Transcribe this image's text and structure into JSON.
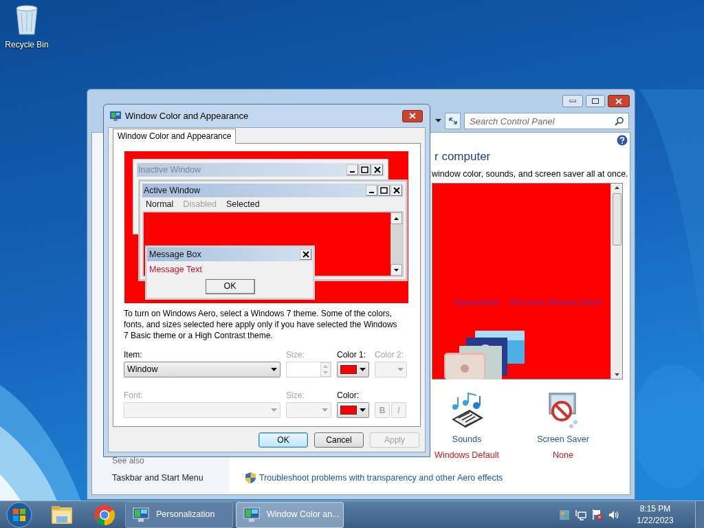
{
  "desktop_icons": [
    {
      "label": "Recycle Bin"
    }
  ],
  "personalization": {
    "search_placeholder": "Search Control Panel",
    "heading": "r computer",
    "description": "window color, sounds, and screen saver all at once.",
    "theme_links": [
      "Save theme",
      "Get more themes online"
    ],
    "settings": [
      {
        "kind": "sounds",
        "label": "Sounds",
        "value": "Windows Default"
      },
      {
        "kind": "screen_saver",
        "label": "Screen Saver",
        "value": "None"
      }
    ],
    "see_also": "See also",
    "see_also_links": [
      "Taskbar and Start Menu"
    ],
    "troubleshoot_link": "Troubleshoot problems with transparency and other Aero effects"
  },
  "dialog": {
    "title": "Window Color and Appearance",
    "tabs": [
      {
        "label": "Window Color and Appearance",
        "selected": true
      }
    ],
    "preview": {
      "inactive_title": "Inactive Window",
      "active_title": "Active Window",
      "menu": [
        {
          "label": "Normal",
          "kind": "normal"
        },
        {
          "label": "Disabled",
          "kind": "disabled"
        },
        {
          "label": "Selected",
          "kind": "selected"
        }
      ],
      "message_box_title": "Message Box",
      "message_text": "Message Text",
      "message_button": "OK"
    },
    "note": "To turn on Windows Aero, select a Windows 7 theme.  Some of the colors, fonts, and sizes selected here apply only if you have selected the Windows 7 Basic theme or a High Contrast theme.",
    "fields": [
      {
        "kind": "dropdown",
        "label": "Item:",
        "value": "Window",
        "disabled": false
      },
      {
        "kind": "spin",
        "label": "Size:",
        "disabled": true
      },
      {
        "kind": "color",
        "label": "Color 1:",
        "color": "#ff0000",
        "disabled": false
      },
      {
        "kind": "color",
        "label": "Color 2:",
        "disabled": true
      },
      {
        "kind": "dropdown",
        "label": "Font:",
        "disabled": true
      },
      {
        "kind": "dropdown",
        "label": "Size:",
        "disabled": true
      },
      {
        "kind": "color",
        "label": "Color:",
        "color": "#ff0000",
        "disabled": false
      },
      {
        "kind": "style",
        "bold": "B",
        "italic": "I",
        "disabled": true
      }
    ],
    "buttons": [
      {
        "label": "OK",
        "default": true,
        "disabled": false
      },
      {
        "label": "Cancel",
        "default": false,
        "disabled": false
      },
      {
        "label": "Apply",
        "default": false,
        "disabled": true
      }
    ]
  },
  "taskbar": {
    "tasks": [
      {
        "label": "Personalization",
        "selected": false
      },
      {
        "label": "Window Color an...",
        "selected": true
      }
    ],
    "time": "8:15 PM",
    "date": "1/22/2023"
  }
}
